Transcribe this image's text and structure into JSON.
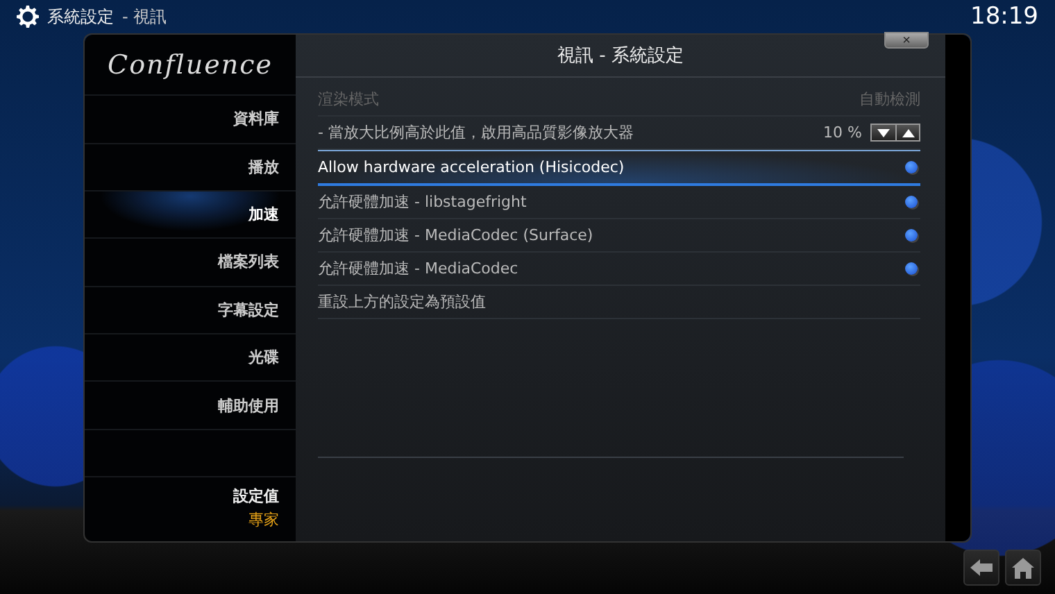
{
  "top_bar": {
    "breadcrumb": [
      "系統設定",
      "- 視訊"
    ],
    "clock": "18:19"
  },
  "dialog": {
    "logo": "Confluence",
    "title": "視訊 - 系統設定",
    "close": "×"
  },
  "sidebar": {
    "items": [
      {
        "label": "資料庫",
        "selected": false
      },
      {
        "label": "播放",
        "selected": false
      },
      {
        "label": "加速",
        "selected": true
      },
      {
        "label": "檔案列表",
        "selected": false
      },
      {
        "label": "字幕設定",
        "selected": false
      },
      {
        "label": "光碟",
        "selected": false
      },
      {
        "label": "輔助使用",
        "selected": false
      }
    ],
    "setting_level": {
      "label": "設定值",
      "value": "專家"
    }
  },
  "settings": [
    {
      "kind": "header",
      "label": "渲染模式",
      "value": "自動檢測",
      "disabled": true,
      "selected": false
    },
    {
      "kind": "spinner",
      "label": "- 當放大比例高於此值，啟用高品質影像放大器",
      "value": "10 %",
      "disabled": false,
      "selected": false
    },
    {
      "kind": "toggle",
      "label": "Allow hardware acceleration (Hisicodec)",
      "on": true,
      "disabled": false,
      "selected": true
    },
    {
      "kind": "toggle",
      "label": "允許硬體加速 - libstagefright",
      "on": true,
      "disabled": false,
      "selected": false
    },
    {
      "kind": "toggle",
      "label": "允許硬體加速 - MediaCodec (Surface)",
      "on": true,
      "disabled": false,
      "selected": false
    },
    {
      "kind": "toggle",
      "label": "允許硬體加速 - MediaCodec",
      "on": true,
      "disabled": false,
      "selected": false
    },
    {
      "kind": "action",
      "label": "重設上方的設定為預設值",
      "disabled": false,
      "selected": false
    }
  ]
}
